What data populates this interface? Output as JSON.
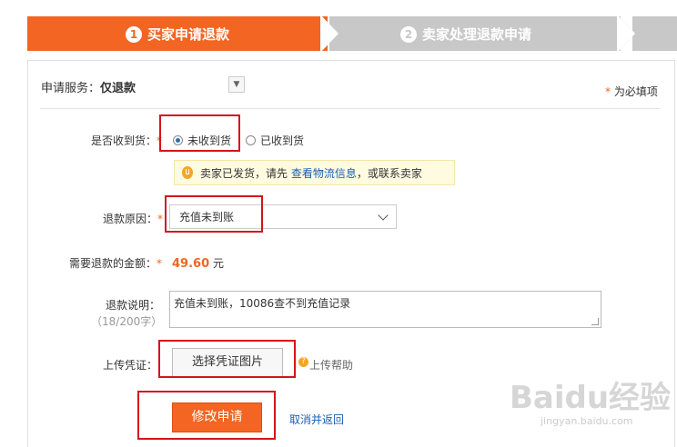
{
  "steps": [
    {
      "num": "1",
      "label": "买家申请退款"
    },
    {
      "num": "2",
      "label": "卖家处理退款申请"
    }
  ],
  "service": {
    "label": "申请服务：",
    "value": "仅退款"
  },
  "required_note": {
    "star": "*",
    "text": " 为必填项"
  },
  "received": {
    "label": "是否收到货：",
    "star": "*",
    "options": [
      {
        "label": "未收到货",
        "selected": true
      },
      {
        "label": "已收到货",
        "selected": false
      }
    ]
  },
  "notice": {
    "before": "卖家已发货，请先 ",
    "link": "查看物流信息",
    "after": "，或联系卖家"
  },
  "reason": {
    "label": "退款原因：",
    "star": "*",
    "value": "充值未到账"
  },
  "amount": {
    "label": "需要退款的金额：",
    "star": "*",
    "value": "49.60",
    "unit": " 元"
  },
  "description": {
    "label": "退款说明：",
    "counter": "（18/200字）",
    "value": "充值未到账，10086查不到充值记录"
  },
  "upload": {
    "label": "上传凭证：",
    "button": "选择凭证图片",
    "help": "上传帮助"
  },
  "actions": {
    "submit": "修改申请",
    "cancel": "取消并返回"
  },
  "watermark": {
    "main": "Baidu经验",
    "sub": "jingyan.baidu.com"
  },
  "colors": {
    "accent": "#f26522",
    "highlight": "#d4141b",
    "link": "#1a5fb4"
  }
}
